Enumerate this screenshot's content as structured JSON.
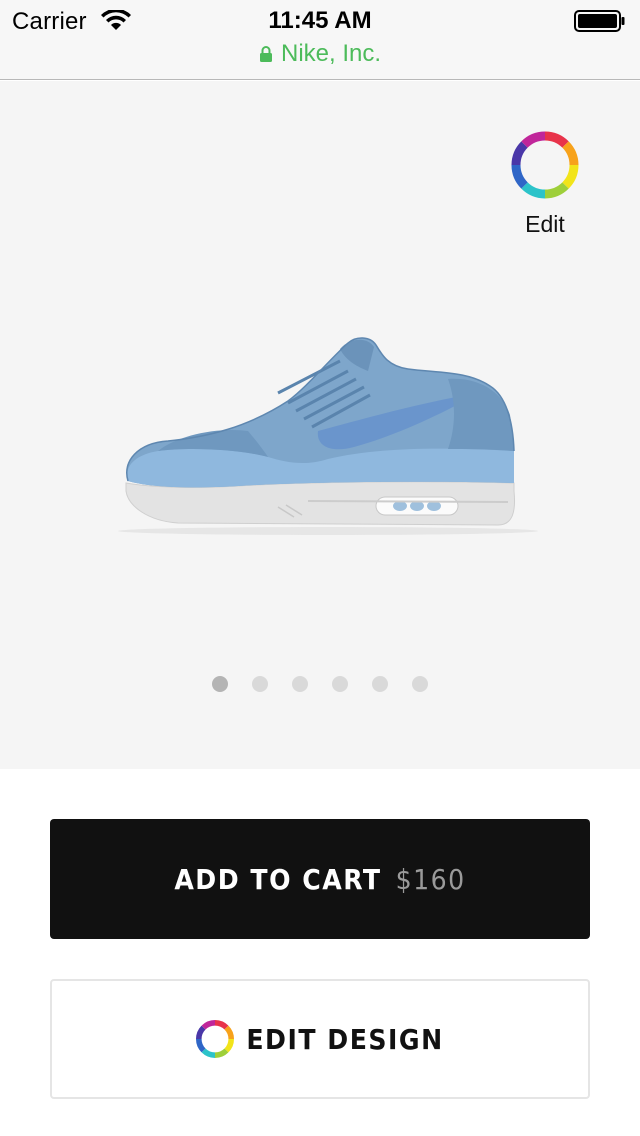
{
  "status_bar": {
    "carrier": "Carrier",
    "time": "11:45 AM",
    "site": "Nike, Inc.",
    "site_color": "#4cbb5a"
  },
  "product": {
    "edit_label": "Edit",
    "image_alt": "Nike Air Max 1 in light blue",
    "shoe_color": "#7fa8cc",
    "pager": {
      "count": 6,
      "active_index": 0
    }
  },
  "actions": {
    "add_to_cart_label": "ADD TO CART",
    "price": "$160",
    "edit_design_label": "EDIT DESIGN"
  },
  "icons": [
    "wifi-icon",
    "battery-icon",
    "lock-icon",
    "color-wheel-icon"
  ]
}
